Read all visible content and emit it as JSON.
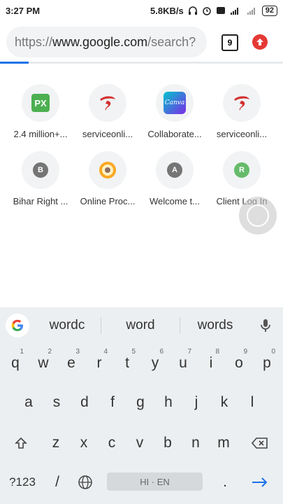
{
  "status": {
    "time": "3:27 PM",
    "speed": "5.8KB/s",
    "battery": "92"
  },
  "browser": {
    "url_prefix": "https://",
    "url_host": "www.google.com",
    "url_rest": "/search?",
    "tab_count": "9",
    "load_progress": 0.1,
    "accent": "#1a73e8"
  },
  "tiles": [
    {
      "label": "2.4 million+...",
      "icon": "px-icon",
      "glyph": "PX",
      "color": "#4caf50"
    },
    {
      "label": "serviceonli...",
      "icon": "service-icon",
      "glyph": "S",
      "color": "#d32f2f"
    },
    {
      "label": "Collaborate...",
      "icon": "canva-icon",
      "glyph": "Canva",
      "color": "#6a5cff"
    },
    {
      "label": "serviceonli...",
      "icon": "service-icon",
      "glyph": "S",
      "color": "#d32f2f"
    },
    {
      "label": "Bihar Right ...",
      "icon": "letter-b-icon",
      "glyph": "B",
      "color": "#757575"
    },
    {
      "label": "Online Proc...",
      "icon": "emblem-icon",
      "glyph": "",
      "color": "#f9a825"
    },
    {
      "label": "Welcome t...",
      "icon": "letter-a-icon",
      "glyph": "A",
      "color": "#757575"
    },
    {
      "label": "Client Log In",
      "icon": "letter-r-icon",
      "glyph": "R",
      "color": "#66bb6a"
    }
  ],
  "keyboard": {
    "suggestions": [
      "wordc",
      "word",
      "words"
    ],
    "row1": [
      {
        "k": "q",
        "h": "1"
      },
      {
        "k": "w",
        "h": "2"
      },
      {
        "k": "e",
        "h": "3"
      },
      {
        "k": "r",
        "h": "4"
      },
      {
        "k": "t",
        "h": "5"
      },
      {
        "k": "y",
        "h": "6"
      },
      {
        "k": "u",
        "h": "7"
      },
      {
        "k": "i",
        "h": "8"
      },
      {
        "k": "o",
        "h": "9"
      },
      {
        "k": "p",
        "h": "0"
      }
    ],
    "row2": [
      "a",
      "s",
      "d",
      "f",
      "g",
      "h",
      "j",
      "k",
      "l"
    ],
    "row3": [
      "z",
      "x",
      "c",
      "v",
      "b",
      "n",
      "m"
    ],
    "symbols_label": "?123",
    "slash": "/",
    "space_label": "HI · EN",
    "period": "."
  }
}
